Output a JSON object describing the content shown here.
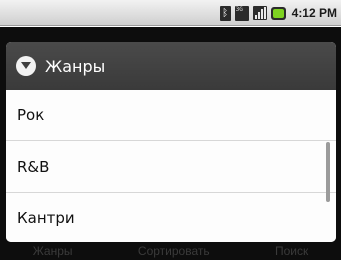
{
  "status_bar": {
    "time": "4:12 PM",
    "icons": [
      "bluetooth-icon",
      "3g-icon",
      "signal-icon",
      "battery-icon"
    ],
    "network_label": "3G"
  },
  "background": {
    "tabs": [
      "Жанры",
      "Сортировать",
      "Поиск"
    ]
  },
  "dialog": {
    "title": "Жанры",
    "title_icon": "chevron-down-circle-icon",
    "items": [
      "Рок",
      "R&B",
      "Кантри"
    ]
  },
  "colors": {
    "header_bg": "#3f3f3f",
    "list_bg": "#fdfdfd",
    "divider": "#d7d7d7",
    "overlay": "#0d0d0d"
  }
}
